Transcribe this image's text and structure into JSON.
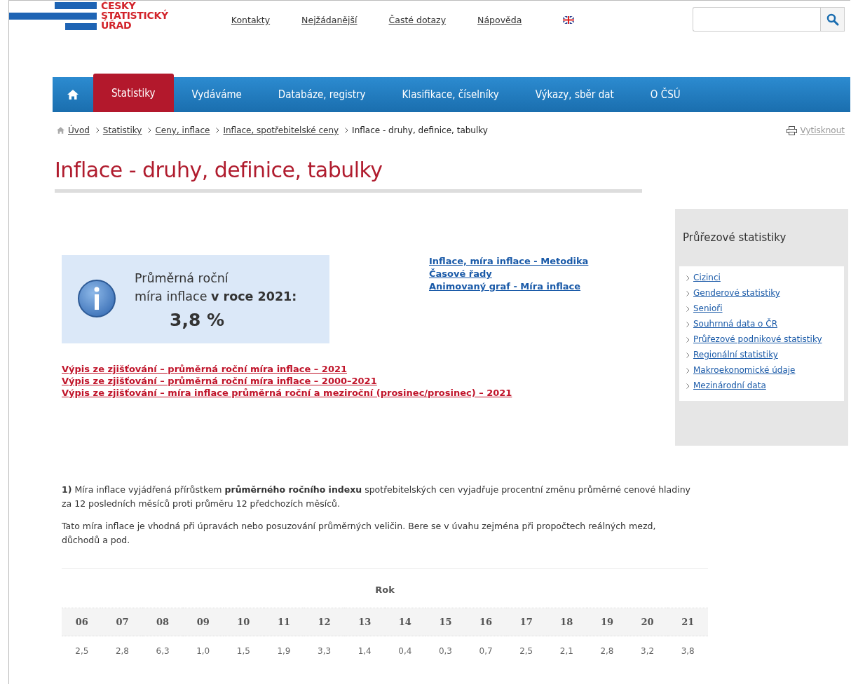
{
  "logo": {
    "lines": [
      "ČESKÝ",
      "STATISTICKÝ",
      "ÚŘAD"
    ]
  },
  "top_links": [
    "Kontakty",
    "Nejžádanější",
    "Časté dotazy",
    "Nápověda"
  ],
  "nav": [
    {
      "label": "Statistiky",
      "selected": true
    },
    {
      "label": "Vydáváme",
      "selected": false
    },
    {
      "label": "Databáze, registry",
      "selected": false
    },
    {
      "label": "Klasifikace, číselníky",
      "selected": false
    },
    {
      "label": "Výkazy, sběr dat",
      "selected": false
    },
    {
      "label": "O ČSÚ",
      "selected": false
    }
  ],
  "breadcrumb": {
    "links": [
      "Úvod",
      "Statistiky",
      "Ceny, inflace",
      "Inflace, spotřebitelské ceny"
    ],
    "current": "Inflace - druhy, definice, tabulky"
  },
  "print_link": "Vytisknout",
  "title": "Inflace - druhy, definice, tabulky",
  "info_box": {
    "lines": [
      "Průměrná roční",
      "míra inflace **v roce 2021:**"
    ],
    "value": "3,8 %"
  },
  "blue_links": [
    "Inflace, míra inflace - Metodika",
    "Časové řady",
    "Animovaný graf - Míra inflace"
  ],
  "red_links": [
    "Výpis ze zjišťování – průměrná roční míra inflace – 2021",
    "Výpis ze zjišťování – průměrná roční míra inflace – 2000–2021",
    "Výpis ze zjišťování – míra inflace průměrná roční a meziroční (prosinec/prosinec) – 2021"
  ],
  "sidebar": {
    "title": "Průřezové statistiky",
    "items": [
      "Cizinci",
      "Genderové statistiky",
      "Senioři",
      "Souhrnná data o ČR",
      "Průřezové podnikové statistiky",
      "Regionální statistiky",
      "Makroekonomické údaje",
      "Mezinárodní data"
    ]
  },
  "paragraphs": [
    "**1)** Míra inflace vyjádřená přírůstkem **průměrného ročního indexu** spotřebitelských cen vyjadřuje procentní změnu průměrné cenové hladiny za 12 posledních měsíců proti průměru 12 předchozích měsíců.",
    "Tato míra inflace je vhodná při úpravách nebo posuzování průměrných veličin. Bere se v úvahu zejména při propočtech reálných mezd, důchodů a pod."
  ],
  "table": {
    "caption": "Rok",
    "columns": [
      "06",
      "07",
      "08",
      "09",
      "10",
      "11",
      "12",
      "13",
      "14",
      "15",
      "16",
      "17",
      "18",
      "19",
      "20",
      "21"
    ],
    "rows": [
      [
        "2,5",
        "2,8",
        "6,3",
        "1,0",
        "1,5",
        "1,9",
        "3,3",
        "1,4",
        "0,4",
        "0,3",
        "0,7",
        "2,5",
        "2,1",
        "2,8",
        "3,2",
        "3,8"
      ]
    ]
  }
}
